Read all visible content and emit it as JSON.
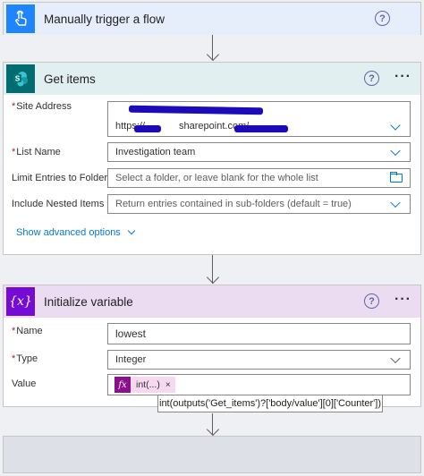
{
  "trigger": {
    "title": "Manually trigger a flow",
    "help": "?",
    "icon": "touch-hand-icon"
  },
  "get_items": {
    "title": "Get items",
    "help": "?",
    "more": "···",
    "icon": "sharepoint-icon",
    "fields": {
      "site_address": {
        "label": "Site Address",
        "value_prefix": "https://",
        "value_middle": "sharepoint.com/"
      },
      "list_name": {
        "label": "List Name",
        "value": "Investigation team"
      },
      "limit_folder": {
        "label": "Limit Entries to Folder",
        "placeholder": "Select a folder, or leave blank for the whole list"
      },
      "nested_items": {
        "label": "Include Nested Items",
        "value": "Return entries contained in sub-folders (default = true)"
      }
    },
    "show_advanced": "Show advanced options"
  },
  "init_var": {
    "title": "Initialize variable",
    "help": "?",
    "more": "···",
    "icon_text": "{x}",
    "fields": {
      "name": {
        "label": "Name",
        "value": "lowest"
      },
      "type": {
        "label": "Type",
        "value": "Integer"
      },
      "value": {
        "label": "Value",
        "token": "int(...)",
        "token_close": "×",
        "fx": "fx"
      }
    },
    "tooltip": "int(outputs('Get_items')?['body/value'][0]['Counter'])"
  },
  "required_marker": "*",
  "colors": {
    "trigger_header": "#e6eefc",
    "trigger_icon": "#1f85ff",
    "sp_header": "#e1eff0",
    "sp_icon": "#036c70",
    "var_header": "#ecdcf2",
    "var_icon": "#770bd6",
    "token_bg": "#f6d9f0",
    "link": "#0078d4"
  }
}
